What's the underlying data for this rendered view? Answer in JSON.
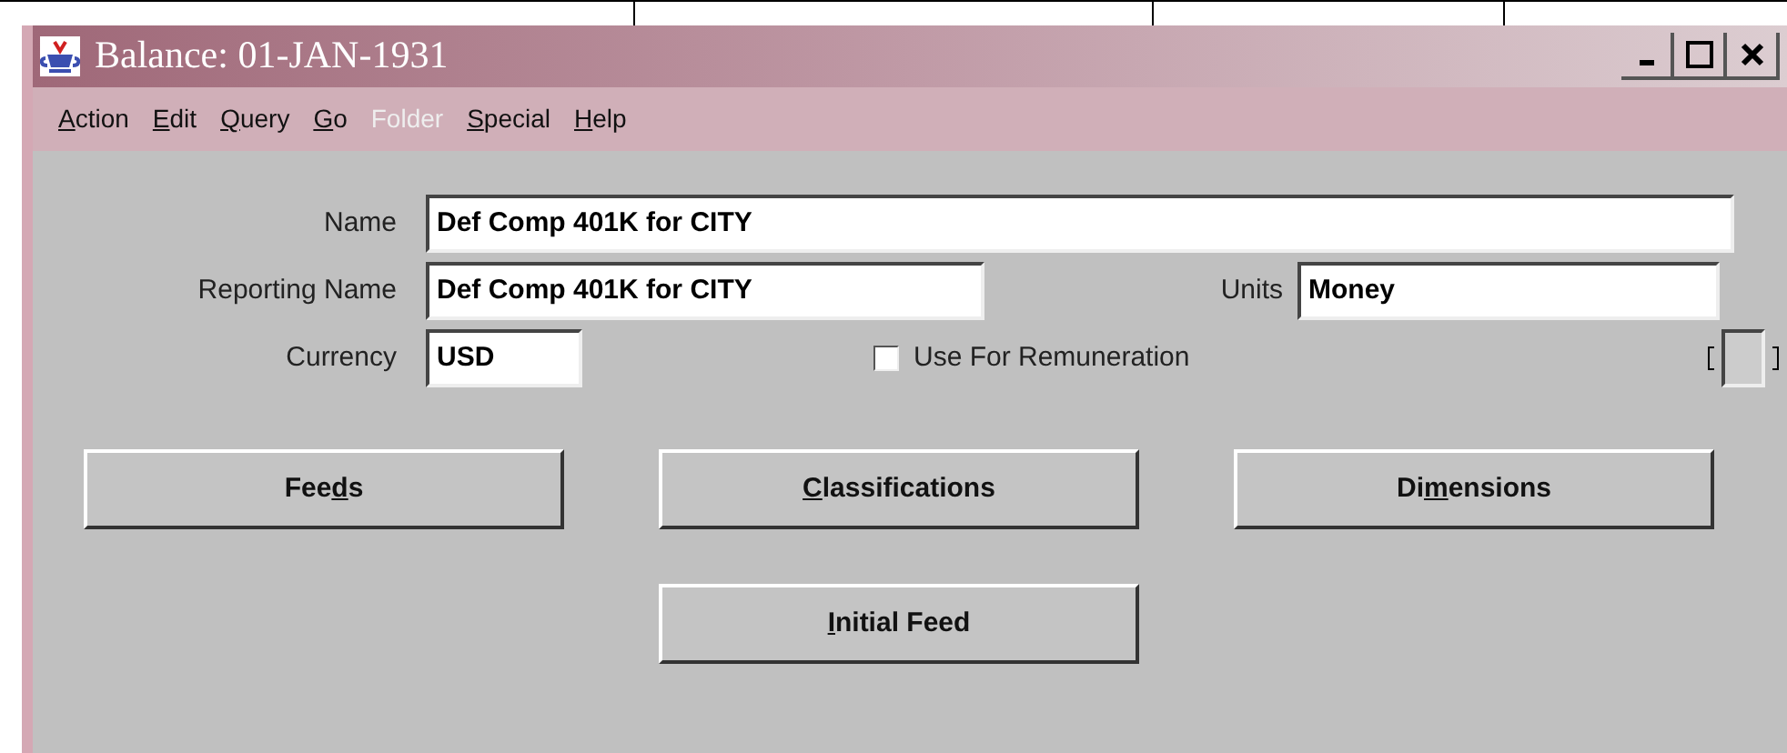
{
  "window": {
    "title": "Balance: 01-JAN-1931"
  },
  "menu": [
    {
      "label": "Action",
      "disabled": false
    },
    {
      "label": "Edit",
      "disabled": false
    },
    {
      "label": "Query",
      "disabled": false
    },
    {
      "label": "Go",
      "disabled": false
    },
    {
      "label": "Folder",
      "disabled": true
    },
    {
      "label": "Special",
      "disabled": false
    },
    {
      "label": "Help",
      "disabled": false
    }
  ],
  "fields": {
    "name": {
      "label": "Name",
      "value": "Def Comp 401K for CITY"
    },
    "reporting_name": {
      "label": "Reporting Name",
      "value": "Def Comp 401K for CITY"
    },
    "units": {
      "label": "Units",
      "value": "Money"
    },
    "currency": {
      "label": "Currency",
      "value": "USD"
    }
  },
  "use_for_remuneration": {
    "label": "Use For Remuneration",
    "checked": false
  },
  "buttons": [
    {
      "before": "Fee",
      "key": "d",
      "after": "s"
    },
    {
      "key": "C",
      "after": "lassifications"
    },
    {
      "before": "Di",
      "key": "m",
      "after": "ensions"
    },
    {
      "key": "I",
      "after": "nitial Feed"
    }
  ]
}
